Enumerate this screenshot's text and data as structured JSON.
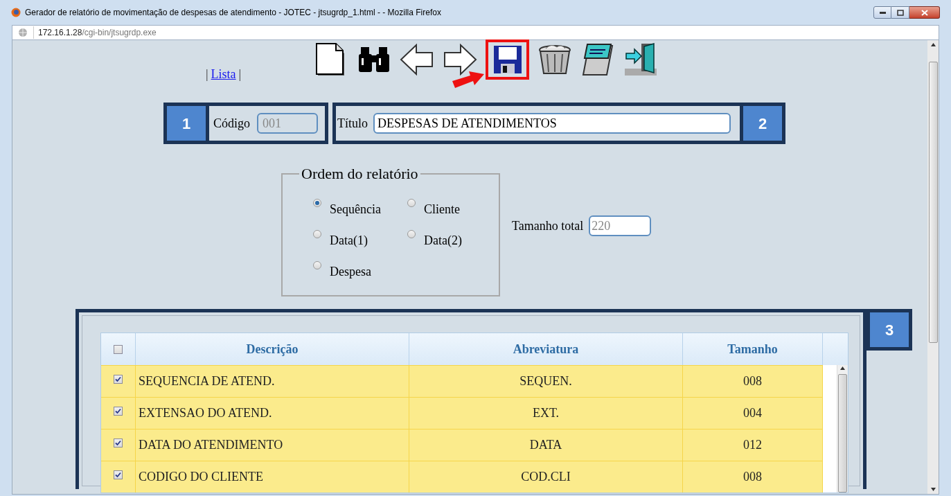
{
  "window": {
    "title": "Gerador de relatório de movimentação de despesas de atendimento - JOTEC - jtsugrdp_1.html - - Mozilla Firefox"
  },
  "address": {
    "host": "172.16.1.28",
    "path": "/cgi-bin/jtsugrdp.exe"
  },
  "nav": {
    "link_left": "|",
    "link": "Lista",
    "link_right": "|"
  },
  "toolbar": [
    {
      "kind": "new",
      "highlighted": false
    },
    {
      "kind": "find",
      "highlighted": false
    },
    {
      "kind": "back",
      "highlighted": false
    },
    {
      "kind": "forward",
      "highlighted": false
    },
    {
      "kind": "save",
      "highlighted": true
    },
    {
      "kind": "delete",
      "highlighted": false
    },
    {
      "kind": "notes",
      "highlighted": false
    },
    {
      "kind": "exit",
      "highlighted": false
    }
  ],
  "callouts": [
    "1",
    "2",
    "3"
  ],
  "codigo": {
    "label": "Código",
    "value": "001"
  },
  "titulo": {
    "label": "Título",
    "value": "DESPESAS DE ATENDIMENTOS"
  },
  "ordem": {
    "legend": "Ordem do relatório",
    "options": [
      {
        "label": "Sequência",
        "selected": true
      },
      {
        "label": "Cliente",
        "selected": false
      },
      {
        "label": "Data(1)",
        "selected": false
      },
      {
        "label": "Data(2)",
        "selected": false
      },
      {
        "label": "Despesa",
        "selected": false
      }
    ]
  },
  "tamanho_total": {
    "label": "Tamanho total",
    "value": "220"
  },
  "table": {
    "all_checked": false,
    "columns": [
      "Descrição",
      "Abreviatura",
      "Tamanho"
    ],
    "rows": [
      {
        "checked": true,
        "cells": [
          "SEQUENCIA DE ATEND.",
          "SEQUEN.",
          "008"
        ]
      },
      {
        "checked": true,
        "cells": [
          "EXTENSAO DO ATEND.",
          "EXT.",
          "004"
        ]
      },
      {
        "checked": true,
        "cells": [
          "DATA DO ATENDIMENTO",
          "DATA",
          "012"
        ]
      },
      {
        "checked": true,
        "cells": [
          "CODIGO DO CLIENTE",
          "COD.CLI",
          "008"
        ]
      }
    ]
  }
}
